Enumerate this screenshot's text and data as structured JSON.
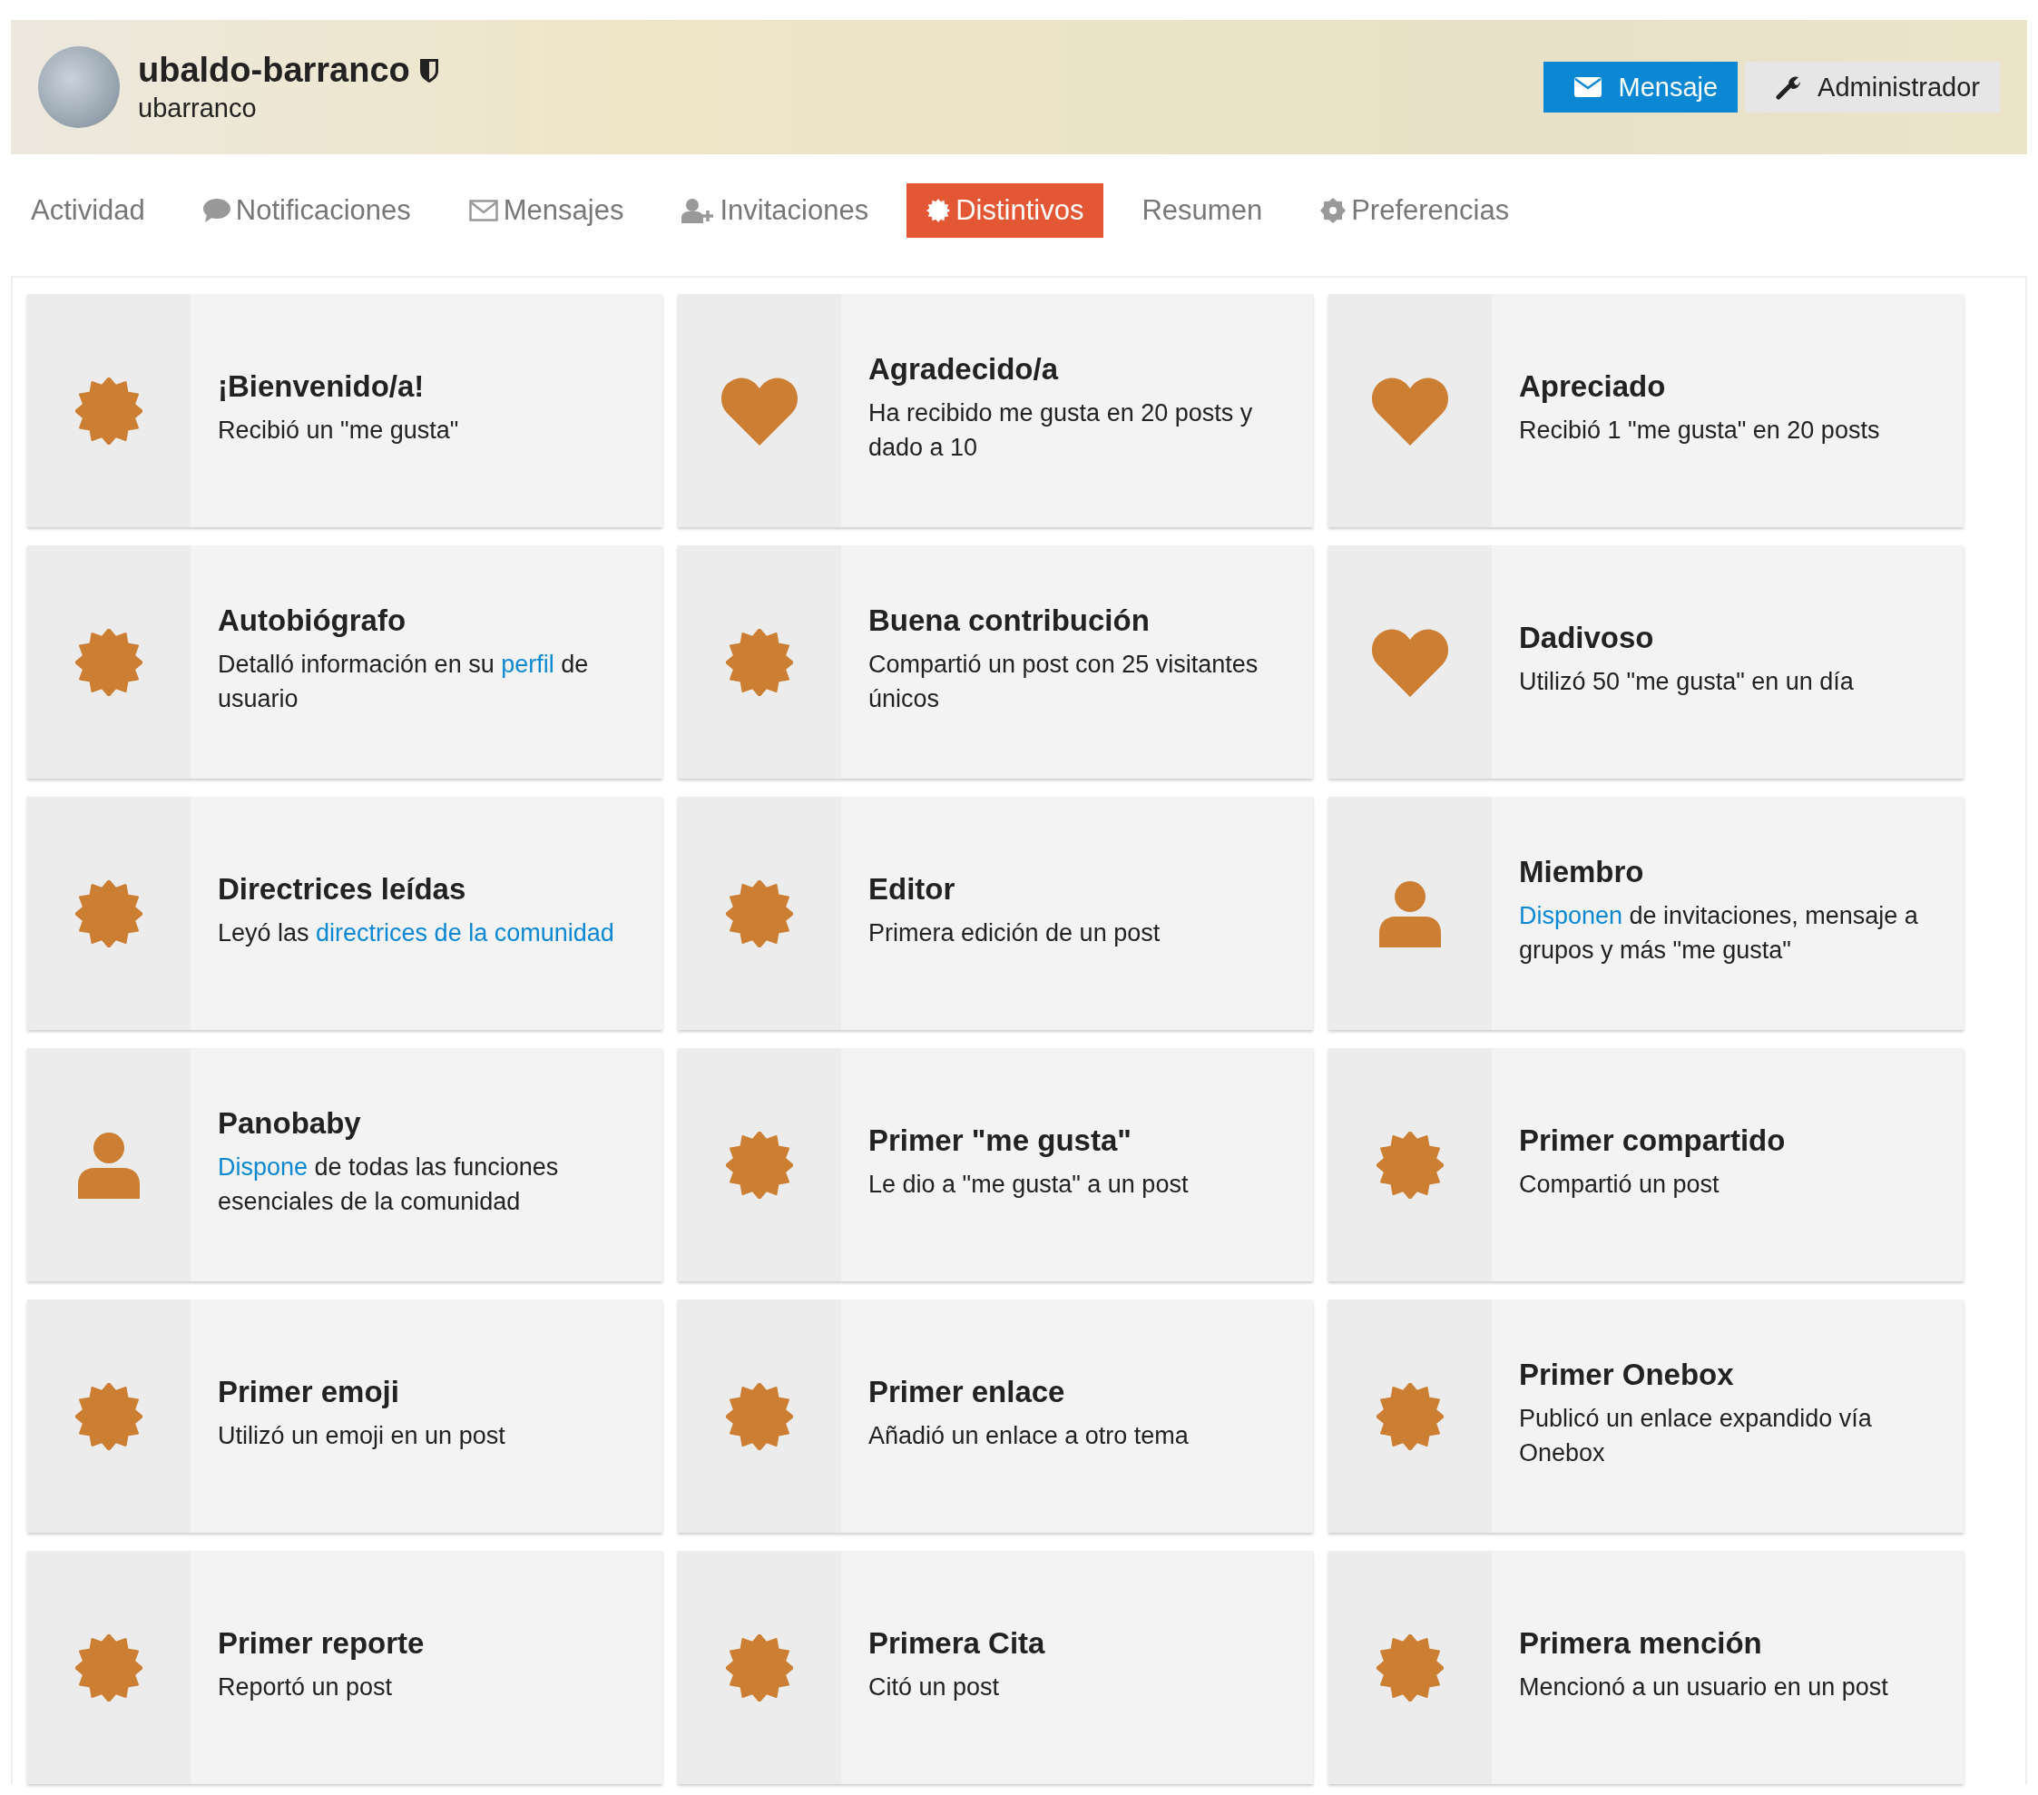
{
  "profile": {
    "name": "ubaldo-barranco",
    "username": "ubarranco",
    "moderator": true,
    "buttons": [
      {
        "label": "Mensaje",
        "kind": "primary"
      },
      {
        "label": "Administrador",
        "kind": "secondary"
      }
    ]
  },
  "tabs": [
    {
      "label": "Actividad",
      "kind": "plain",
      "selected": false
    },
    {
      "label": "Notificaciones",
      "kind": "chat",
      "selected": false
    },
    {
      "label": "Mensajes",
      "kind": "mail",
      "selected": false
    },
    {
      "label": "Invitaciones",
      "kind": "invite",
      "selected": false
    },
    {
      "label": "Distintivos",
      "kind": "badge",
      "selected": true
    },
    {
      "label": "Resumen",
      "kind": "plain",
      "selected": false
    },
    {
      "label": "Preferencias",
      "kind": "gear",
      "selected": false
    }
  ],
  "badges": [
    {
      "kind": "burst",
      "title": "¡Bienvenido/a!",
      "description": [
        {
          "text": "Recibió un \"me gusta\""
        }
      ]
    },
    {
      "kind": "heart",
      "title": "Agradecido/a",
      "description": [
        {
          "text": "Ha recibido me gusta en 20 posts y dado a 10"
        }
      ]
    },
    {
      "kind": "heart",
      "title": "Apreciado",
      "description": [
        {
          "text": "Recibió 1 \"me gusta\" en 20 posts"
        }
      ]
    },
    {
      "kind": "burst",
      "title": "Autobiógrafo",
      "description": [
        {
          "text": "Detalló información en su "
        },
        {
          "text": "perfil",
          "link": true
        },
        {
          "text": " de usuario"
        }
      ]
    },
    {
      "kind": "burst",
      "title": "Buena contribución",
      "description": [
        {
          "text": "Compartió un post con 25 visitantes únicos"
        }
      ]
    },
    {
      "kind": "heart",
      "title": "Dadivoso",
      "description": [
        {
          "text": "Utilizó 50 \"me gusta\" en un día"
        }
      ]
    },
    {
      "kind": "burst",
      "title": "Directrices leídas",
      "description": [
        {
          "text": "Leyó las "
        },
        {
          "text": "directrices de la comunidad",
          "link": true
        }
      ]
    },
    {
      "kind": "burst",
      "title": "Editor",
      "description": [
        {
          "text": "Primera edición de un post"
        }
      ]
    },
    {
      "kind": "user",
      "title": "Miembro",
      "description": [
        {
          "text": "Disponen",
          "link": true
        },
        {
          "text": " de invitaciones, mensaje a grupos y más \"me gusta\""
        }
      ]
    },
    {
      "kind": "user",
      "title": "Panobaby",
      "description": [
        {
          "text": "Dispone",
          "link": true
        },
        {
          "text": " de todas las funciones esenciales de la comunidad"
        }
      ]
    },
    {
      "kind": "burst",
      "title": "Primer \"me gusta\"",
      "description": [
        {
          "text": "Le dio a \"me gusta\" a un post"
        }
      ]
    },
    {
      "kind": "burst",
      "title": "Primer compartido",
      "description": [
        {
          "text": "Compartió un post"
        }
      ]
    },
    {
      "kind": "burst",
      "title": "Primer emoji",
      "description": [
        {
          "text": "Utilizó un emoji en un post"
        }
      ]
    },
    {
      "kind": "burst",
      "title": "Primer enlace",
      "description": [
        {
          "text": "Añadió un enlace a otro tema"
        }
      ]
    },
    {
      "kind": "burst",
      "title": "Primer Onebox",
      "description": [
        {
          "text": "Publicó un enlace expandido vía Onebox"
        }
      ]
    },
    {
      "kind": "burst",
      "title": "Primer reporte",
      "description": [
        {
          "text": "Reportó un post"
        }
      ]
    },
    {
      "kind": "burst",
      "title": "Primera Cita",
      "description": [
        {
          "text": "Citó un post"
        }
      ]
    },
    {
      "kind": "burst",
      "title": "Primera mención",
      "description": [
        {
          "text": "Mencionó a un usuario en un post"
        }
      ]
    }
  ]
}
